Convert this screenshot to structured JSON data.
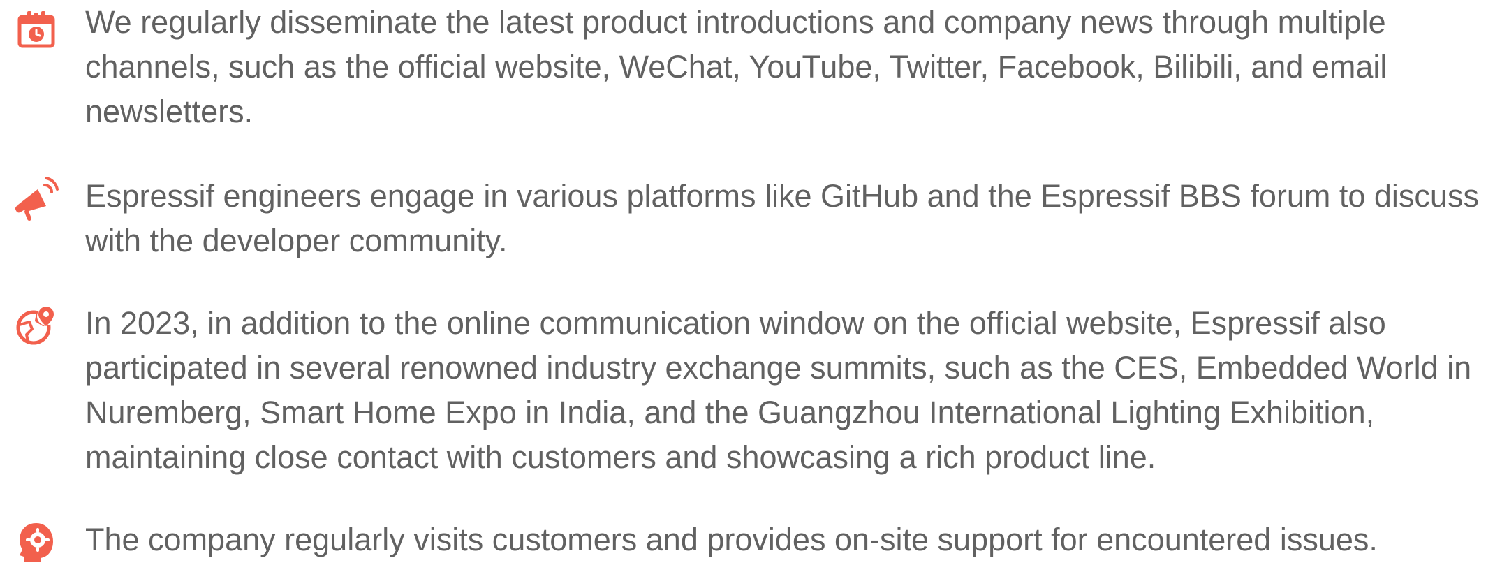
{
  "accent_color": "#f2604d",
  "text_color": "#616161",
  "items": [
    {
      "icon": "calendar-icon",
      "text": "We regularly disseminate the latest product introductions and company news through multiple channels, such as the official website, WeChat, YouTube, Twitter, Facebook, Bilibili, and email newsletters."
    },
    {
      "icon": "megaphone-icon",
      "text": "Espressif engineers engage in various platforms like GitHub and the Espressif BBS forum to discuss with the developer community."
    },
    {
      "icon": "globe-location-icon",
      "text": "In 2023, in addition to the online communication window on the official website, Espressif also participated in several renowned industry exchange summits, such as the CES, Embedded World in Nuremberg, Smart Home Expo in India, and the Guangzhou International Lighting Exhibition, maintaining close contact with customers and showcasing a rich product line."
    },
    {
      "icon": "head-gear-icon",
      "text": "The company regularly visits customers and provides on-site support for encountered issues."
    }
  ]
}
